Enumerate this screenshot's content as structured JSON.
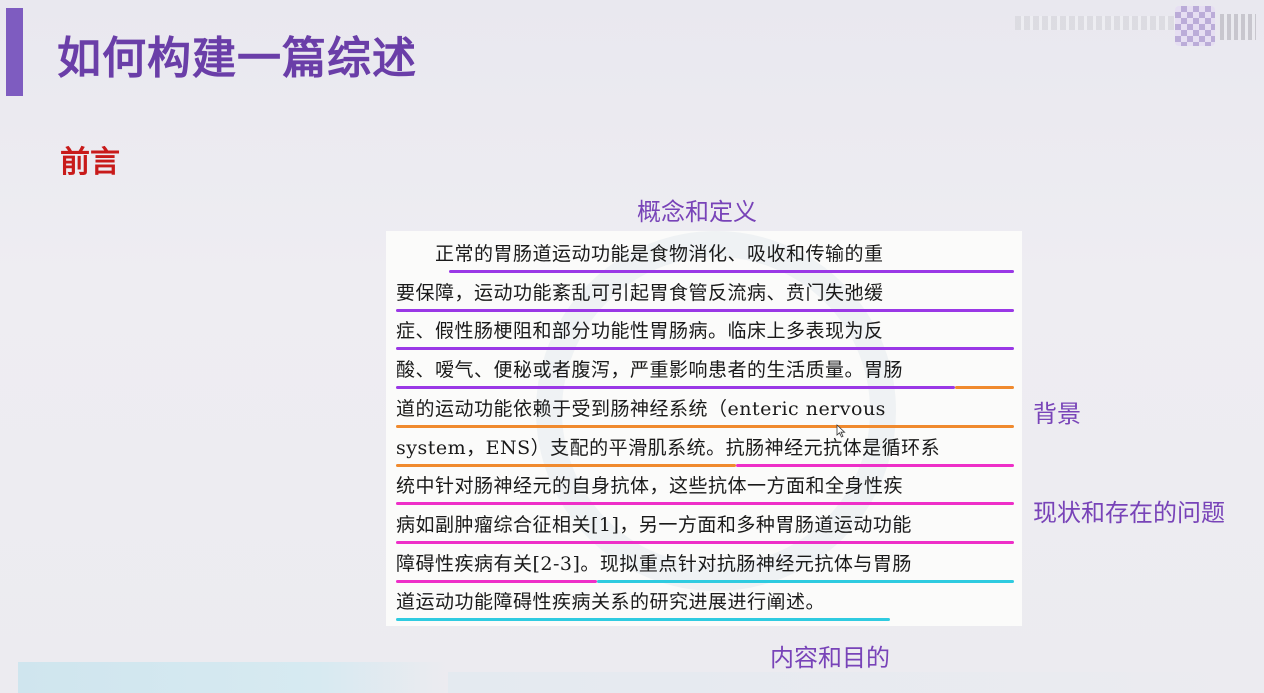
{
  "slide": {
    "title": "如何构建一篇综述",
    "section_heading": "前言"
  },
  "labels": {
    "concept": "概念和定义",
    "background": "背景",
    "status": "现状和存在的问题",
    "content": "内容和目的"
  },
  "colors": {
    "accent": "#7e5cc0",
    "title": "#6a3ea8",
    "heading_red": "#c81a1a",
    "label_purple": "#7843b8",
    "underline_purple": "#9a38e6",
    "underline_orange": "#f08a2e",
    "underline_magenta": "#ee2fc8",
    "underline_cyan": "#2fcbe0"
  },
  "document": {
    "lines": [
      {
        "text": "　　正常的胃肠道运动功能是食物消化、吸收和传输的重",
        "segments": [
          {
            "from": 0.086,
            "to": 1.0,
            "color": "purple"
          }
        ]
      },
      {
        "text": "要保障，运动功能紊乱可引起胃食管反流病、贲门失弛缓",
        "segments": [
          {
            "from": 0.0,
            "to": 1.0,
            "color": "purple"
          }
        ]
      },
      {
        "text": "症、假性肠梗阻和部分功能性胃肠病。临床上多表现为反",
        "segments": [
          {
            "from": 0.0,
            "to": 1.0,
            "color": "purple"
          }
        ]
      },
      {
        "text": "酸、嗳气、便秘或者腹泻，严重影响患者的生活质量。胃肠",
        "segments": [
          {
            "from": 0.0,
            "to": 0.905,
            "color": "purple"
          },
          {
            "from": 0.905,
            "to": 1.0,
            "color": "orange"
          }
        ]
      },
      {
        "text": "道的运动功能依赖于受到肠神经系统（enteric nervous",
        "segments": [
          {
            "from": 0.0,
            "to": 1.0,
            "color": "orange"
          }
        ]
      },
      {
        "text": "system，ENS）支配的平滑肌系统。抗肠神经元抗体是循环系",
        "segments": [
          {
            "from": 0.0,
            "to": 0.55,
            "color": "orange"
          },
          {
            "from": 0.55,
            "to": 1.0,
            "color": "magenta"
          }
        ]
      },
      {
        "text": "统中针对肠神经元的自身抗体，这些抗体一方面和全身性疾",
        "segments": [
          {
            "from": 0.0,
            "to": 1.0,
            "color": "magenta"
          }
        ]
      },
      {
        "text": "病如副肿瘤综合征相关[1]，另一方面和多种胃肠道运动功能",
        "segments": [
          {
            "from": 0.0,
            "to": 1.0,
            "color": "magenta"
          }
        ]
      },
      {
        "text": "障碍性疾病有关[2-3]。现拟重点针对抗肠神经元抗体与胃肠",
        "segments": [
          {
            "from": 0.0,
            "to": 0.325,
            "color": "magenta"
          },
          {
            "from": 0.325,
            "to": 1.0,
            "color": "cyan"
          }
        ]
      },
      {
        "text": "道运动功能障碍性疾病关系的研究进展进行阐述。",
        "segments": [
          {
            "from": 0.0,
            "to": 0.8,
            "color": "cyan"
          }
        ]
      }
    ]
  },
  "icons": {
    "cursor": "mouse-cursor-icon",
    "watermark_logo": "watermark-logo-icon"
  }
}
